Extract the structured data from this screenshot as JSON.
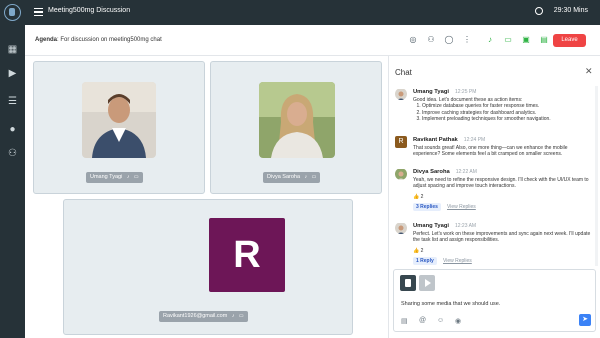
{
  "topbar": {
    "title": "Meeting500mg Discussion",
    "timer": "29:30 Mins"
  },
  "agenda": {
    "label": "Agenda",
    "text": ": For discussion on meeting500mg chat"
  },
  "toolbar": {
    "leave_label": "Leave"
  },
  "participants": [
    {
      "name": "Umang Tyagi"
    },
    {
      "name": "Divya Saroha"
    },
    {
      "name": "Ravikant1926@gmail.com",
      "initial": "R"
    }
  ],
  "chat": {
    "title": "Chat",
    "messages": [
      {
        "author": "Umang Tyagi",
        "time": "12:25 PM",
        "intro": "Good idea. Let's document these as action items:",
        "items": [
          "Optimize database queries for faster response times.",
          "Improve caching strategies for dashboard analytics.",
          "Implement preloading techniques for smoother navigation."
        ]
      },
      {
        "author": "Ravikant Pathak",
        "initial": "R",
        "time": "12:24 PM",
        "text": "That sounds great! Also, one more thing—can we enhance the mobile experience? Some elements feel a bit cramped on smaller screens."
      },
      {
        "author": "Divya Saroha",
        "time": "12:22 AM",
        "text": "Yeah, we need to refine the responsive design. I'll check with the UI/UX team to adjust spacing and improve touch interactions.",
        "reaction": "👍 2",
        "replies": "3 Replies",
        "view_replies": "View Replies"
      },
      {
        "author": "Umang Tyagi",
        "time": "12:23 AM",
        "text": "Perfect. Let's work on these improvements and sync again next week. I'll update the task list and assign responsibilities.",
        "reaction": "👍 2",
        "replies": "1 Reply",
        "view_replies": "View Replies"
      }
    ],
    "composer": {
      "text": "Sharing some media that we should use."
    }
  },
  "colors": {
    "dark": "#263238",
    "leave": "#ef4444",
    "accent_green": "#2fb344",
    "avatar_r": "#6d1657",
    "send": "#3b82f6"
  }
}
